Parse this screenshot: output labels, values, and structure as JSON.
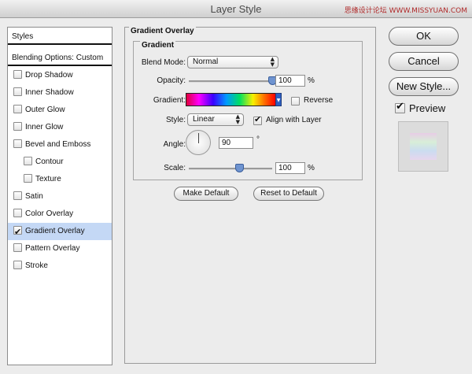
{
  "window": {
    "title": "Layer Style",
    "watermark": "思缘设计论坛 WWW.MISSYUAN.COM"
  },
  "styles_panel": {
    "header": "Styles",
    "blending": "Blending Options: Custom",
    "items": [
      {
        "label": "Drop Shadow",
        "checked": false
      },
      {
        "label": "Inner Shadow",
        "checked": false
      },
      {
        "label": "Outer Glow",
        "checked": false
      },
      {
        "label": "Inner Glow",
        "checked": false
      },
      {
        "label": "Bevel and Emboss",
        "checked": false
      },
      {
        "label": "Contour",
        "checked": false
      },
      {
        "label": "Texture",
        "checked": false
      },
      {
        "label": "Satin",
        "checked": false
      },
      {
        "label": "Color Overlay",
        "checked": false
      },
      {
        "label": "Gradient Overlay",
        "checked": true,
        "active": true
      },
      {
        "label": "Pattern Overlay",
        "checked": false
      },
      {
        "label": "Stroke",
        "checked": false
      }
    ]
  },
  "gradient_overlay": {
    "title": "Gradient Overlay",
    "group_title": "Gradient",
    "blend_mode_label": "Blend Mode:",
    "blend_mode_value": "Normal",
    "opacity_label": "Opacity:",
    "opacity_value": "100",
    "opacity_unit": "%",
    "opacity_level": 1.0,
    "gradient_label": "Gradient:",
    "reverse_label": "Reverse",
    "reverse_checked": false,
    "style_label": "Style:",
    "style_value": "Linear",
    "align_label": "Align with Layer",
    "align_checked": true,
    "angle_label": "Angle:",
    "angle_value": "90",
    "angle_unit": "°",
    "scale_label": "Scale:",
    "scale_value": "100",
    "scale_unit": "%",
    "scale_level": 0.6,
    "make_default_label": "Make Default",
    "reset_default_label": "Reset to Default"
  },
  "actions": {
    "ok_label": "OK",
    "cancel_label": "Cancel",
    "new_style_label": "New Style...",
    "preview_label": "Preview",
    "preview_checked": true
  },
  "colors": {
    "selection": "#c4d8f5",
    "knob": "#6f94d0",
    "swatch_button": "#2f5fc1"
  }
}
